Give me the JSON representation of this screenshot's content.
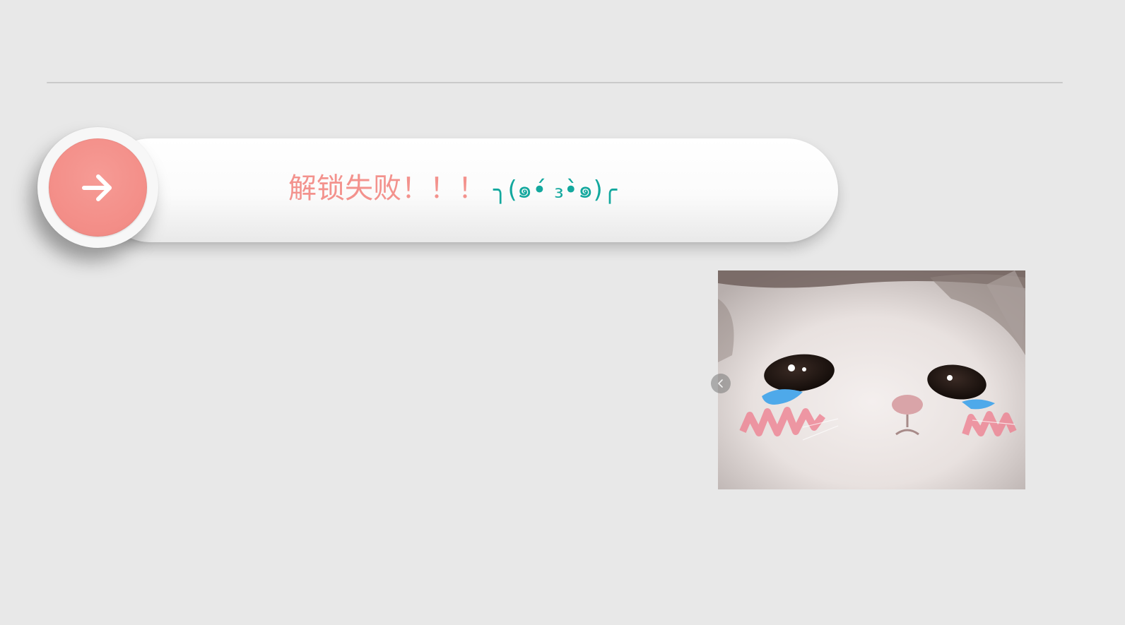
{
  "slider": {
    "status_text": "解锁失败！！！",
    "emoticon": "╮(๑•́ ₃•̀๑)╭",
    "status_color": "#f3928d",
    "emoticon_color": "#13a89e",
    "knob_color": "#f3928d",
    "knob_icon": "arrow-right-icon"
  },
  "image": {
    "subject": "crying-cat-meme"
  },
  "carousel": {
    "prev_icon": "chevron-left-icon"
  }
}
